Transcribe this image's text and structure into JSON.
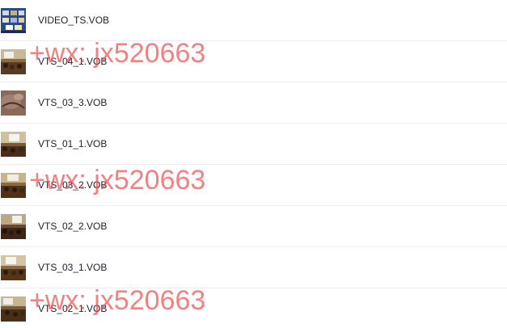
{
  "files": [
    {
      "name": "VIDEO_TS.VOB",
      "thumb": "dvd-menu-thumbnail"
    },
    {
      "name": "VTS_04_1.VOB",
      "thumb": "conference-room-thumbnail"
    },
    {
      "name": "VTS_03_3.VOB",
      "thumb": "closeup-thumbnail"
    },
    {
      "name": "VTS_01_1.VOB",
      "thumb": "conference-room-thumbnail"
    },
    {
      "name": "VTS_03_2.VOB",
      "thumb": "conference-room-thumbnail"
    },
    {
      "name": "VTS_02_2.VOB",
      "thumb": "conference-room-thumbnail"
    },
    {
      "name": "VTS_03_1.VOB",
      "thumb": "conference-room-thumbnail"
    },
    {
      "name": "VTS_02_1.VOB",
      "thumb": "conference-room-thumbnail"
    }
  ],
  "watermark": {
    "text": "+wx: jx520663",
    "color": "#f05050"
  }
}
